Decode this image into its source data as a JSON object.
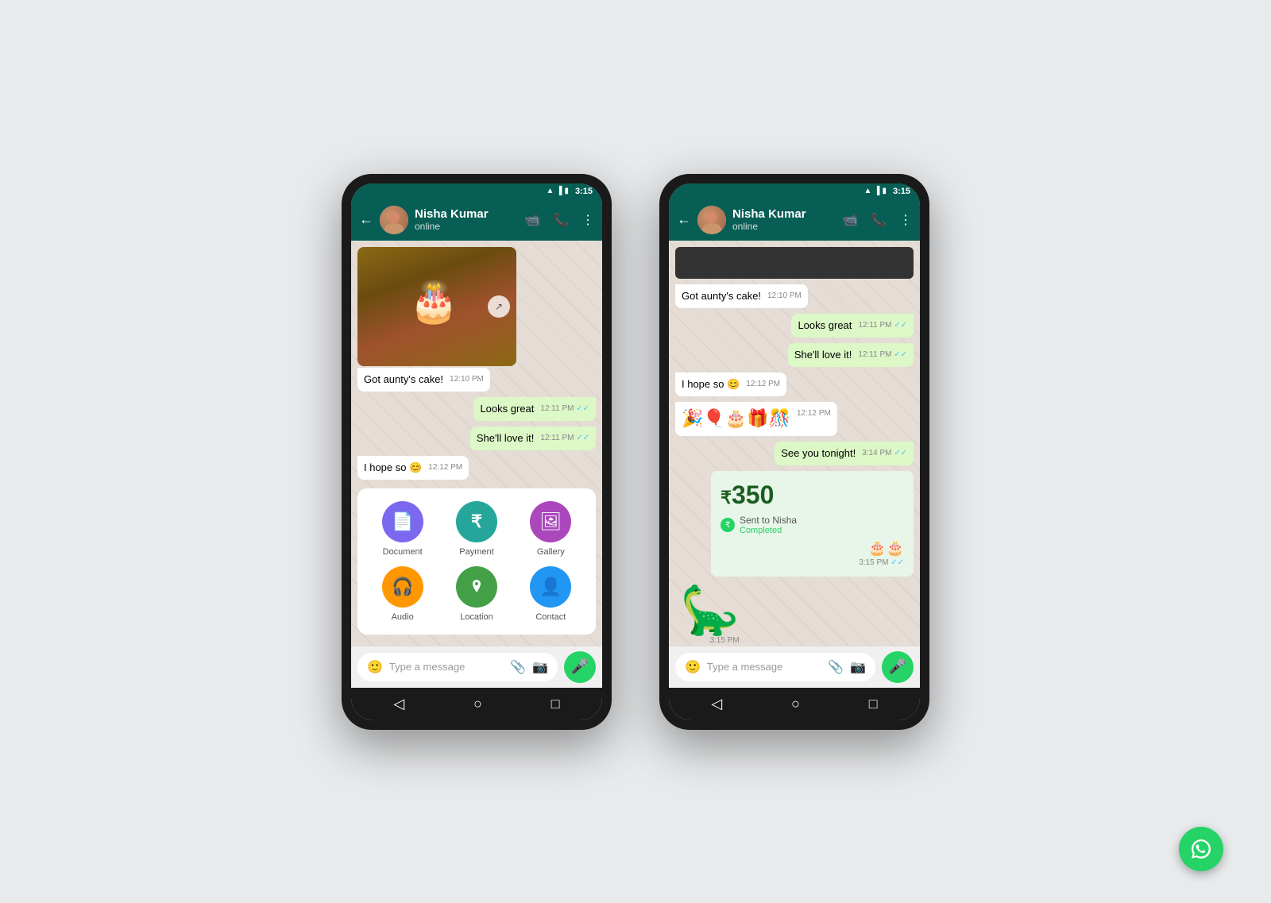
{
  "page": {
    "background": "#e8eaec"
  },
  "phone1": {
    "statusBar": {
      "time": "3:15",
      "icons": [
        "wifi",
        "signal",
        "battery"
      ]
    },
    "header": {
      "contact": "Nisha Kumar",
      "status": "online",
      "backLabel": "←"
    },
    "messages": [
      {
        "id": "img-msg",
        "type": "image",
        "sender": "received"
      },
      {
        "id": "cake-text",
        "text": "Got aunty's cake!",
        "time": "12:10 PM",
        "type": "received"
      },
      {
        "id": "looks-great",
        "text": "Looks great",
        "time": "12:11 PM",
        "type": "sent",
        "ticks": "✓✓"
      },
      {
        "id": "shell-love",
        "text": "She'll love it!",
        "time": "12:11 PM",
        "type": "sent",
        "ticks": "✓✓"
      },
      {
        "id": "hope-so",
        "text": "I hope so 😊",
        "time": "12:12 PM",
        "type": "received"
      }
    ],
    "attachmentMenu": {
      "items": [
        {
          "id": "document",
          "label": "Document",
          "icon": "📄",
          "color": "#7b68ee"
        },
        {
          "id": "payment",
          "label": "Payment",
          "icon": "₹",
          "color": "#26a69a"
        },
        {
          "id": "gallery",
          "label": "Gallery",
          "icon": "🖼",
          "color": "#ab47bc"
        },
        {
          "id": "audio",
          "label": "Audio",
          "icon": "🎧",
          "color": "#ff9800"
        },
        {
          "id": "location",
          "label": "Location",
          "icon": "📍",
          "color": "#43a047"
        },
        {
          "id": "contact",
          "label": "Contact",
          "icon": "👤",
          "color": "#2196f3"
        }
      ]
    },
    "inputBar": {
      "placeholder": "Type a message"
    }
  },
  "phone2": {
    "statusBar": {
      "time": "3:15",
      "icons": [
        "wifi",
        "signal",
        "battery"
      ]
    },
    "header": {
      "contact": "Nisha Kumar",
      "status": "online",
      "backLabel": "←"
    },
    "messages": [
      {
        "id": "cake-text2",
        "text": "Got aunty's cake!",
        "time": "12:10 PM",
        "type": "received"
      },
      {
        "id": "looks-great2",
        "text": "Looks great",
        "time": "12:11 PM",
        "type": "sent",
        "ticks": "✓✓"
      },
      {
        "id": "shell-love2",
        "text": "She'll love it!",
        "time": "12:11 PM",
        "type": "sent",
        "ticks": "✓✓"
      },
      {
        "id": "hope-so2",
        "text": "I hope so 😊",
        "time": "12:12 PM",
        "type": "received"
      },
      {
        "id": "emoji-party",
        "text": "🎉🎈🎂🎁🎊",
        "time": "12:12 PM",
        "type": "received"
      },
      {
        "id": "see-tonight",
        "text": "See you tonight!",
        "time": "3:14 PM",
        "type": "sent",
        "ticks": "✓✓"
      },
      {
        "id": "payment",
        "type": "payment",
        "amount": "350",
        "to": "Sent to Nisha",
        "status": "Completed",
        "time": "3:15 PM",
        "ticks": "✓✓"
      },
      {
        "id": "sticker",
        "text": "🦕",
        "time": "3:15 PM",
        "type": "received",
        "isSticker": true
      }
    ],
    "inputBar": {
      "placeholder": "Type a message"
    }
  },
  "waLogo": "💬"
}
